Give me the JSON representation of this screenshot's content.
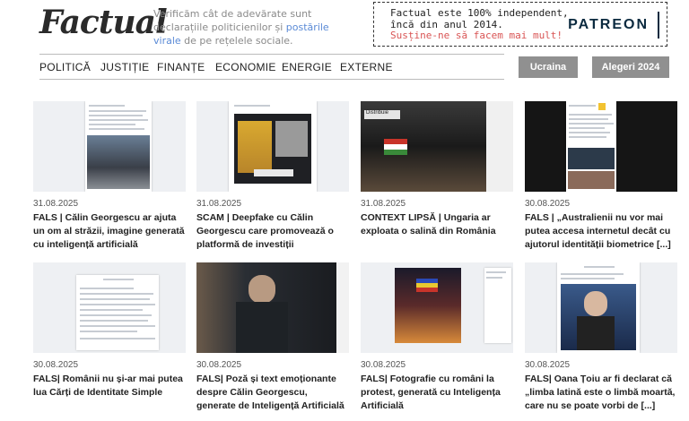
{
  "header": {
    "logo": "Factual",
    "tagline_start": "Verificăm cât de adevărate sunt declarațiile politicienilor și ",
    "tagline_link": "postările virale",
    "tagline_end": " de pe rețelele sociale."
  },
  "patreon": {
    "line1": "Factual este 100% independent,",
    "line1b": "încă din anul 2014.",
    "line2": "Susține-ne să facem mai mult!",
    "logo": "PATREON"
  },
  "nav": {
    "items": [
      "POLITICĂ",
      "JUSTIȚIE",
      "FINANȚE",
      "ECONOMIE",
      "ENERGIE",
      "EXTERNE"
    ],
    "pills": [
      "Ucraina",
      "Alegeri 2024"
    ]
  },
  "articles": [
    {
      "date": "31.08.2025",
      "title": "FALS | Călin Georgescu ar ajuta un om al străzii, imagine generată cu inteligență artificială"
    },
    {
      "date": "31.08.2025",
      "title": "SCAM | Deepfake cu Călin Georgescu care promovează o platformă de investiții"
    },
    {
      "date": "31.08.2025",
      "title": "CONTEXT LIPSĂ | Ungaria ar exploata o salină din România"
    },
    {
      "date": "30.08.2025",
      "title": "FALS | „Australienii nu vor mai putea accesa internetul decât cu ajutorul identității biometrice [...]"
    },
    {
      "date": "30.08.2025",
      "title": "FALS| Românii nu și-ar mai putea lua Cărți de Identitate Simple"
    },
    {
      "date": "30.08.2025",
      "title": "FALS| Poză și text emoționante despre Călin Georgescu, generate de Inteligență Artificială"
    },
    {
      "date": "30.08.2025",
      "title": "FALS| Fotografie cu români la protest, generată cu Inteligența Artificială"
    },
    {
      "date": "30.08.2025",
      "title": "FALS| Oana Țoiu ar fi declarat că „limba latină este o limbă moartă, care nu se poate vorbi de [...]"
    }
  ],
  "thumb_labels": {
    "salina": "Distribuie"
  },
  "colors": {
    "accent_link": "#5a8ad6",
    "patreon_red": "#d95454",
    "pill_bg": "#909090"
  }
}
